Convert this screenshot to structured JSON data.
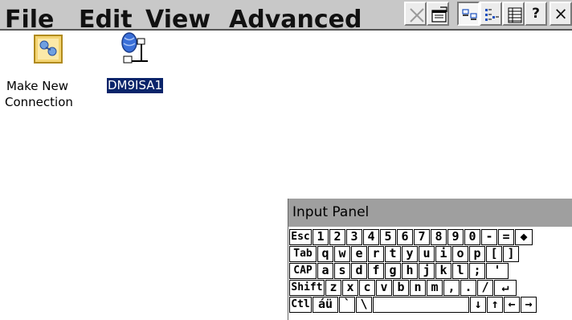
{
  "menu": {
    "file": "File",
    "edit": "Edit",
    "view": "View",
    "advanced": "Advanced"
  },
  "toolbar": {
    "help_glyph": "?",
    "close_glyph": "×",
    "icons": [
      "delete-icon",
      "properties-icon",
      "large-icons-view-icon",
      "small-icons-view-icon",
      "details-view-icon",
      "help-icon",
      "close-icon"
    ]
  },
  "desktop": {
    "items": [
      {
        "label_line1": "Make New",
        "label_line2": "Connection",
        "icon": "make-new-connection-icon"
      },
      {
        "label": "DM9ISA1",
        "icon": "network-connection-icon",
        "selected": true
      }
    ]
  },
  "input_panel": {
    "title": "Input Panel",
    "rows": [
      [
        "Esc",
        "1",
        "2",
        "3",
        "4",
        "5",
        "6",
        "7",
        "8",
        "9",
        "0",
        "-",
        "=",
        "◆"
      ],
      [
        "Tab",
        "q",
        "w",
        "e",
        "r",
        "t",
        "y",
        "u",
        "i",
        "o",
        "p",
        "[",
        "]"
      ],
      [
        "CAP",
        "a",
        "s",
        "d",
        "f",
        "g",
        "h",
        "j",
        "k",
        "l",
        ";",
        "'"
      ],
      [
        "Shift",
        "z",
        "x",
        "c",
        "v",
        "b",
        "n",
        "m",
        ",",
        ".",
        "/",
        "↵"
      ],
      [
        "Ctl",
        "áü",
        "`",
        "\\",
        "",
        "↓",
        "↑",
        "←",
        "→"
      ]
    ]
  },
  "colors": {
    "menubar_bg": "#c8c8c8",
    "panel_title_bg": "#9f9f9f",
    "selection_bg": "#0a246a"
  }
}
